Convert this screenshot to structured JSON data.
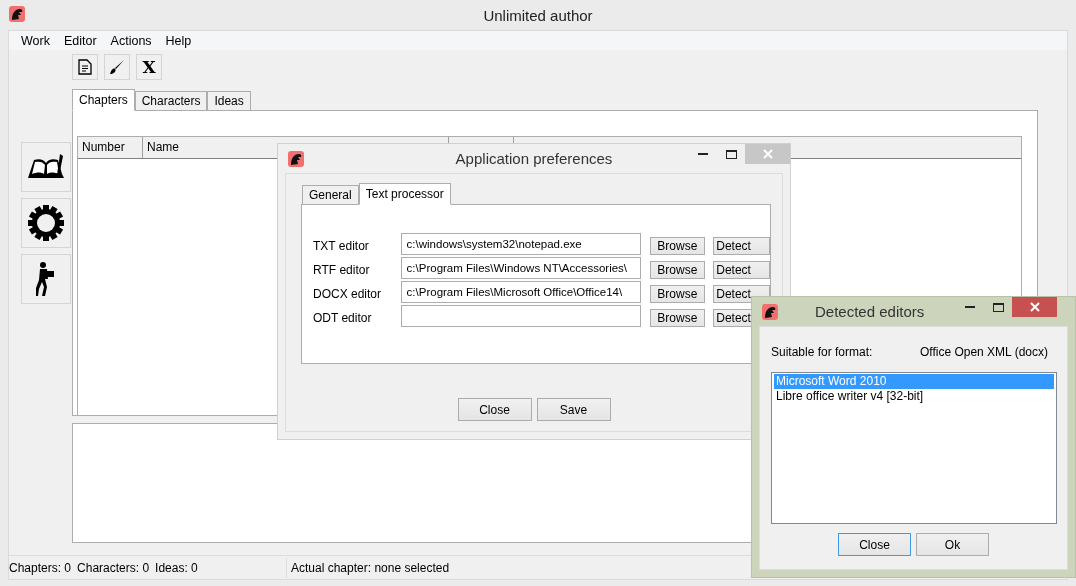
{
  "window": {
    "title": "Unlimited author"
  },
  "menu": [
    "Work",
    "Editor",
    "Actions",
    "Help"
  ],
  "toolbar": [
    {
      "kind": "document"
    },
    {
      "kind": "brush"
    },
    {
      "kind": "letter",
      "label": "X"
    }
  ],
  "sidebar": [
    {
      "kind": "book"
    },
    {
      "kind": "gear"
    },
    {
      "kind": "porter"
    }
  ],
  "tabs": [
    {
      "label": "Chapters",
      "selected": true
    },
    {
      "label": "Characters",
      "selected": false
    },
    {
      "label": "Ideas",
      "selected": false
    }
  ],
  "table": {
    "columns": [
      "Number",
      "Name"
    ]
  },
  "status_bar": {
    "counts": [
      "Chapters: 0",
      "Characters: 0",
      "Ideas: 0"
    ],
    "chapter": "Actual chapter: none selected"
  },
  "preferences": {
    "title": "Application preferences",
    "active": false,
    "tabs": [
      {
        "label": "General",
        "selected": false
      },
      {
        "label": "Text processor",
        "selected": true
      }
    ],
    "rows": [
      {
        "label": "TXT editor",
        "value": "c:\\windows\\system32\\notepad.exe",
        "browse": "Browse",
        "detect": "Detect"
      },
      {
        "label": "RTF editor",
        "value": "c:\\Program Files\\Windows NT\\Accessories\\",
        "browse": "Browse",
        "detect": "Detect"
      },
      {
        "label": "DOCX editor",
        "value": "c:\\Program Files\\Microsoft Office\\Office14\\",
        "browse": "Browse",
        "detect": "Detect"
      },
      {
        "label": "ODT editor",
        "browse": "Browse",
        "detect": "Detect"
      }
    ],
    "buttons": [
      {
        "label": "Close",
        "focused": false
      },
      {
        "label": "Save",
        "focused": false
      }
    ]
  },
  "detected": {
    "title": "Detected editors",
    "active": true,
    "format_label": "Suitable for format:",
    "format_value": "Office Open XML (docx)",
    "editors": [
      {
        "name": "Microsoft Word 2010",
        "selected": true
      },
      {
        "name": "Libre office writer v4 [32-bit]",
        "selected": false
      }
    ],
    "buttons": [
      {
        "label": "Close",
        "focused": true
      },
      {
        "label": "Ok",
        "focused": false
      }
    ]
  }
}
